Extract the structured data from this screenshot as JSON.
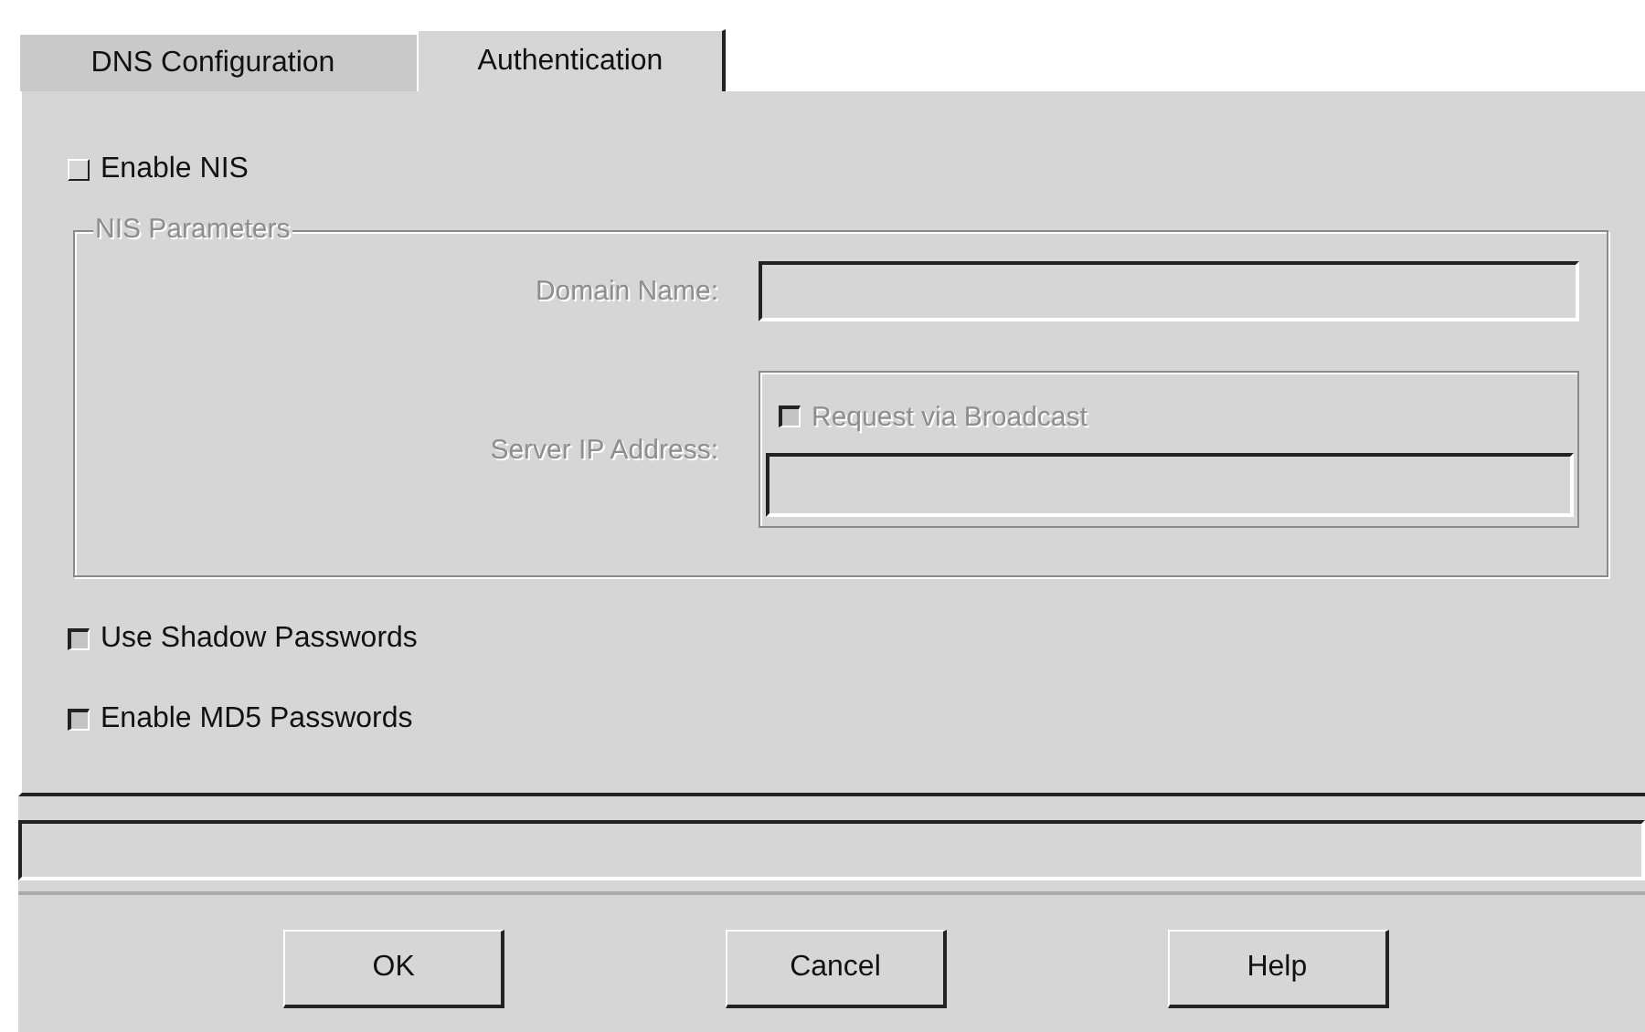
{
  "tabs": [
    {
      "label": "DNS Configuration",
      "selected": false
    },
    {
      "label": "Authentication",
      "selected": true
    }
  ],
  "enable_nis": {
    "label": "Enable NIS",
    "checked": false
  },
  "nis_parameters": {
    "title": "NIS Parameters",
    "disabled": true,
    "domain_name": {
      "label": "Domain Name:"
    },
    "server_ip": {
      "label": "Server IP Address:",
      "broadcast": {
        "label": "Request via Broadcast",
        "checked": true
      }
    }
  },
  "options": [
    {
      "label": "Use Shadow Passwords",
      "checked": true
    },
    {
      "label": "Enable MD5 Passwords",
      "checked": true
    }
  ],
  "buttons": [
    "OK",
    "Cancel",
    "Help"
  ]
}
